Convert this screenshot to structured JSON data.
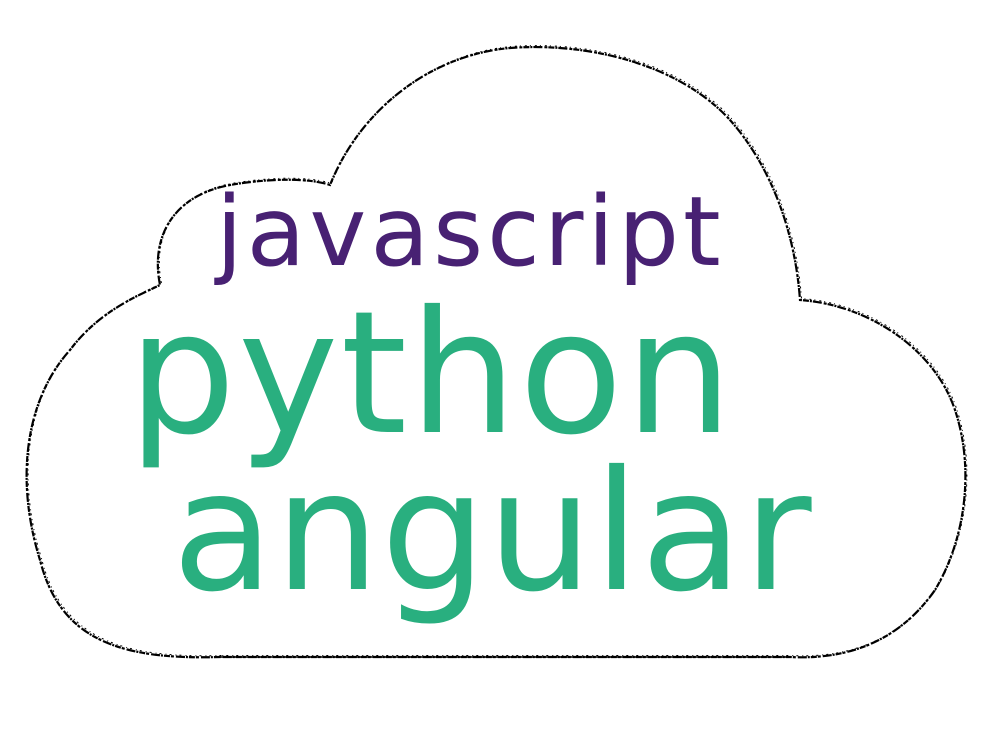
{
  "words": [
    {
      "text": "javascript",
      "color": "#482173"
    },
    {
      "text": "python",
      "color": "#29AF7F"
    },
    {
      "text": "angular",
      "color": "#29AF7F"
    }
  ],
  "cloud": {
    "icon": "cloud-outline-icon",
    "outline_color": "#000000",
    "fill_color": "#ffffff"
  }
}
